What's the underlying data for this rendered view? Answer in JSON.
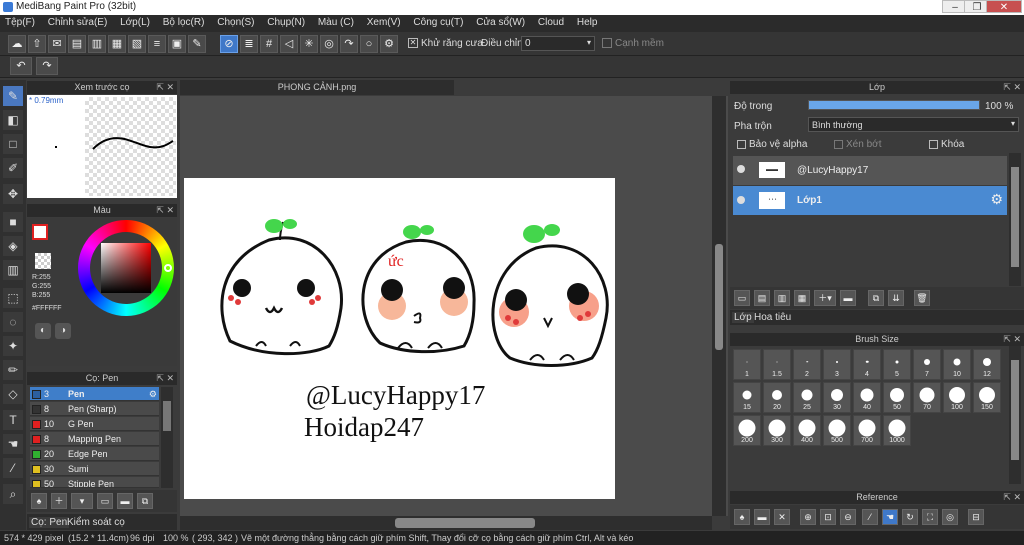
{
  "window": {
    "title": "MediBang Paint Pro (32bit)"
  },
  "menu": [
    "Tệp(F)",
    "Chỉnh sửa(E)",
    "Lớp(L)",
    "Bộ lọc(R)",
    "Chọn(S)",
    "Chụp(N)",
    "Màu (C)",
    "Xem(V)",
    "Công cụ(T)",
    "Cửa sổ(W)",
    "Cloud",
    "Help"
  ],
  "toolopt": {
    "antialias": "Khử răng cưa",
    "adjust_label": "Điều chỉnh",
    "adjust_value": "0",
    "edge": "Cạnh mềm"
  },
  "brush_preview": {
    "title": "Xem trước cọ",
    "size": "* 0.79mm"
  },
  "color_panel": {
    "title": "Màu",
    "r": "R:255",
    "g": "G:255",
    "b": "B:255",
    "hex": "#FFFFFF"
  },
  "brush_panel": {
    "title": "Cọ: Pen",
    "items": [
      {
        "size": "3",
        "name": "Pen",
        "color": "#2c5fa0"
      },
      {
        "size": "8",
        "name": "Pen (Sharp)",
        "color": "#333333"
      },
      {
        "size": "10",
        "name": "G Pen",
        "color": "#e02020"
      },
      {
        "size": "8",
        "name": "Mapping Pen",
        "color": "#e02020"
      },
      {
        "size": "20",
        "name": "Edge Pen",
        "color": "#30b030"
      },
      {
        "size": "30",
        "name": "Sumi",
        "color": "#e0c020"
      },
      {
        "size": "50",
        "name": "Stipple Pen",
        "color": "#e0c020"
      }
    ]
  },
  "bottom_tabs": {
    "tab1": "Cọ: Pen",
    "tab2": "Kiểm soát cọ"
  },
  "document": {
    "tab": "PHONG CẢNH.png",
    "text1": "@LucyHappy17",
    "text2": "Hoidap247",
    "mark": "ức"
  },
  "layer_panel": {
    "title": "Lớp",
    "opacity_label": "Độ trong",
    "opacity_value": "100 %",
    "opacity": 1.0,
    "blend_label": "Pha trộn",
    "blend_value": "Bình thường",
    "protect": "Bảo vệ alpha",
    "clip": "Xén bớt",
    "lock": "Khóa",
    "layers": [
      {
        "name": "@LucyHappy17",
        "selected": false
      },
      {
        "name": "Lớp1",
        "selected": true
      }
    ],
    "tab1": "Lớp",
    "tab2": "Hoa tiêu"
  },
  "brush_size": {
    "title": "Brush Size",
    "sizes": [
      "1",
      "1.5",
      "2",
      "3",
      "4",
      "5",
      "7",
      "10",
      "12",
      "15",
      "20",
      "25",
      "30",
      "40",
      "50",
      "70",
      "100",
      "150",
      "200",
      "300",
      "400",
      "500",
      "700",
      "1000"
    ]
  },
  "reference": {
    "title": "Reference"
  },
  "status": {
    "size": "574 * 429 pixel",
    "cm": "(15.2 * 11.4cm)",
    "dpi": "96 dpi",
    "zoom": "100 %",
    "coords": "( 293, 342 )",
    "hint": "Vẽ một đường thẳng bằng cách giữ phím Shift, Thay đổi cỡ cọ bằng cách giữ phím Ctrl, Alt và kéo"
  }
}
